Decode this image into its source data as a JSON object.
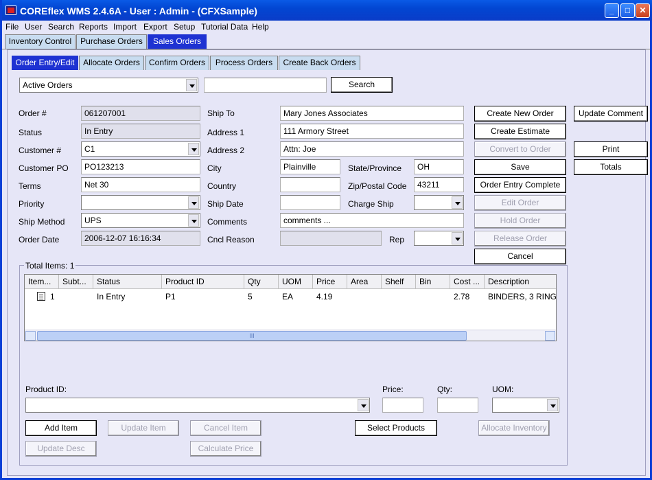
{
  "window": {
    "title": "COREflex WMS 2.4.6A - User : Admin - (CFXSample)"
  },
  "menu": [
    "File",
    "User",
    "Search",
    "Reports",
    "Import",
    "Export",
    "Setup",
    "Tutorial Data",
    "Help"
  ],
  "top_tabs": [
    {
      "label": "Inventory Control",
      "active": false
    },
    {
      "label": "Purchase Orders",
      "active": false
    },
    {
      "label": "Sales Orders",
      "active": true
    }
  ],
  "sub_tabs": [
    {
      "label": "Order Entry/Edit",
      "active": true
    },
    {
      "label": "Allocate Orders",
      "active": false
    },
    {
      "label": "Confirm Orders",
      "active": false
    },
    {
      "label": "Process Orders",
      "active": false
    },
    {
      "label": "Create Back Orders",
      "active": false
    }
  ],
  "search": {
    "filter": "Active Orders",
    "query": "",
    "button": "Search"
  },
  "order": {
    "order_no_label": "Order #",
    "order_no": "061207001",
    "status_label": "Status",
    "status": "In Entry",
    "customer_label": "Customer #",
    "customer": "C1",
    "customer_po_label": "Customer PO",
    "customer_po": "PO123213",
    "terms_label": "Terms",
    "terms": "Net 30",
    "priority_label": "Priority",
    "priority": "",
    "ship_method_label": "Ship Method",
    "ship_method": "UPS",
    "order_date_label": "Order Date",
    "order_date": "2006-12-07 16:16:34"
  },
  "shipping": {
    "ship_to_label": "Ship To",
    "ship_to": "Mary Jones Associates",
    "address1_label": "Address 1",
    "address1": "111 Armory Street",
    "address2_label": "Address 2",
    "address2": "Attn: Joe",
    "city_label": "City",
    "city": "Plainville",
    "state_label": "State/Province",
    "state": "OH",
    "country_label": "Country",
    "country": "",
    "zip_label": "Zip/Postal Code",
    "zip": "43211",
    "ship_date_label": "Ship Date",
    "ship_date": "",
    "charge_ship_label": "Charge Ship",
    "charge_ship": "",
    "comments_label": "Comments",
    "comments": "comments ...",
    "cncl_reason_label": "Cncl Reason",
    "cncl_reason": "",
    "rep_label": "Rep",
    "rep": ""
  },
  "actions": {
    "create_new_order": "Create New Order",
    "create_estimate": "Create Estimate",
    "convert_to_order": "Convert to Order",
    "save": "Save",
    "order_entry_complete": "Order Entry Complete",
    "edit_order": "Edit Order",
    "hold_order": "Hold Order",
    "release_order": "Release Order",
    "cancel": "Cancel",
    "update_comment": "Update Comment",
    "print": "Print",
    "totals": "Totals"
  },
  "items": {
    "total_label": "Total Items: 1",
    "columns": [
      "Item...",
      "Subt...",
      "Status",
      "Product ID",
      "Qty",
      "UOM",
      "Price",
      "Area",
      "Shelf",
      "Bin",
      "Cost ...",
      "Description"
    ],
    "rows": [
      [
        "1",
        "",
        "In Entry",
        "P1",
        "5",
        "EA",
        "4.19",
        "",
        "",
        "",
        "2.78",
        "BINDERS, 3 RING"
      ]
    ],
    "scroll_glyph": "III"
  },
  "entry": {
    "product_id_label": "Product ID:",
    "product_id": "",
    "price_label": "Price:",
    "price": "",
    "qty_label": "Qty:",
    "qty": "",
    "uom_label": "UOM:",
    "uom": "",
    "add_item": "Add Item",
    "update_item": "Update Item",
    "cancel_item": "Cancel Item",
    "select_products": "Select Products",
    "allocate_inventory": "Allocate Inventory",
    "update_desc": "Update Desc",
    "calculate_price": "Calculate Price"
  }
}
